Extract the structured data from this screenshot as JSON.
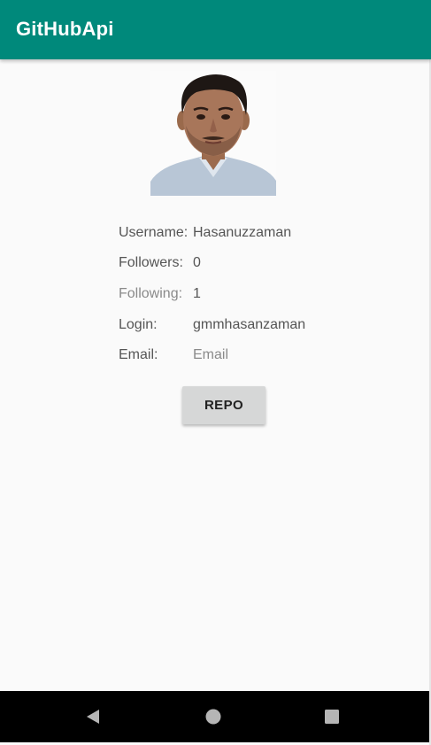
{
  "app": {
    "title": "GitHubApi"
  },
  "colors": {
    "appbar": "#00897b",
    "background": "#fafafa",
    "button": "#d6d7d7",
    "navbar": "#000000"
  },
  "profile": {
    "avatar_alt": "profile photo",
    "fields": [
      {
        "label": "Username:",
        "value": "Hasanuzzaman"
      },
      {
        "label": "Followers:",
        "value": "0"
      },
      {
        "label": "Following:",
        "value": "1"
      },
      {
        "label": "Login:",
        "value": "gmmhasanzaman"
      },
      {
        "label": "Email:",
        "value": "Email"
      }
    ]
  },
  "actions": {
    "repo_label": "REPO"
  },
  "navbar": {
    "back_icon": "back-triangle-icon",
    "home_icon": "home-circle-icon",
    "recents_icon": "recents-square-icon"
  }
}
